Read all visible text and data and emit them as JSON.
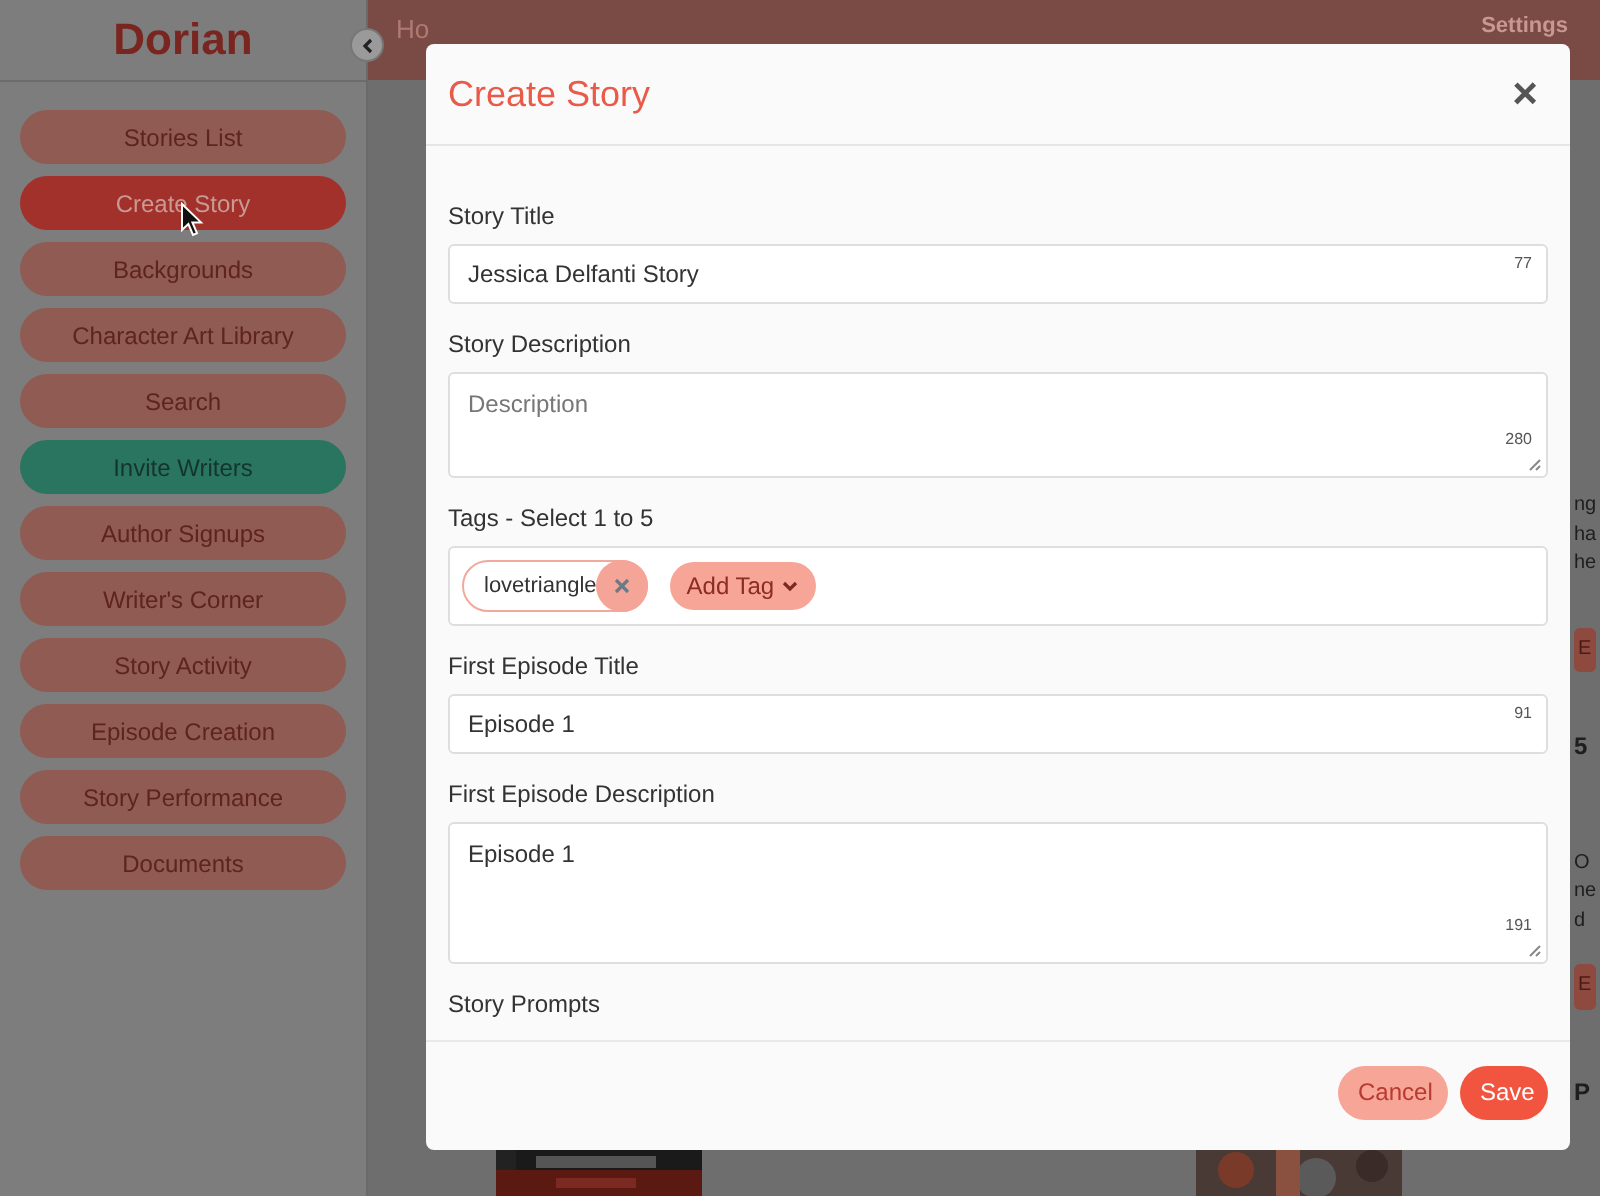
{
  "sidebar": {
    "brand": "Dorian",
    "items": [
      {
        "label": "Stories List",
        "selected": false,
        "kind": "nav"
      },
      {
        "label": "Create Story",
        "selected": true,
        "kind": "nav"
      },
      {
        "label": "Backgrounds",
        "selected": false,
        "kind": "nav"
      },
      {
        "label": "Character Art Library",
        "selected": false,
        "kind": "nav"
      },
      {
        "label": "Search",
        "selected": false,
        "kind": "nav"
      },
      {
        "label": "Invite Writers",
        "selected": false,
        "kind": "invite"
      },
      {
        "label": "Author Signups",
        "selected": false,
        "kind": "nav"
      },
      {
        "label": "Writer's Corner",
        "selected": false,
        "kind": "nav"
      },
      {
        "label": "Story Activity",
        "selected": false,
        "kind": "nav"
      },
      {
        "label": "Episode Creation",
        "selected": false,
        "kind": "nav"
      },
      {
        "label": "Story Performance",
        "selected": false,
        "kind": "nav"
      },
      {
        "label": "Documents",
        "selected": false,
        "kind": "nav"
      }
    ]
  },
  "header": {
    "home": "Ho",
    "settings": "Settings"
  },
  "background_fragments": [
    {
      "text": "ng",
      "kind": "text"
    },
    {
      "text": "ha",
      "kind": "text"
    },
    {
      "text": "he",
      "kind": "text"
    },
    {
      "text": "E",
      "kind": "button"
    },
    {
      "text": "5",
      "kind": "heading"
    },
    {
      "text": "O",
      "kind": "text"
    },
    {
      "text": "ne",
      "kind": "text"
    },
    {
      "text": "d",
      "kind": "text"
    },
    {
      "text": "E",
      "kind": "button"
    },
    {
      "text": "P",
      "kind": "heading"
    }
  ],
  "modal": {
    "title": "Create Story",
    "close": "×",
    "fields": [
      {
        "label": "Story Title",
        "kind": "input",
        "value": "Jessica Delfanti  Story",
        "counter": "77"
      },
      {
        "label": "Story Description",
        "kind": "textarea",
        "placeholder": "Description",
        "counter": "280"
      },
      {
        "label": "Tags - Select 1 to 5",
        "kind": "tags",
        "tags": [
          "lovetriangle"
        ],
        "add": "Add Tag"
      },
      {
        "label": "First Episode Title",
        "kind": "input",
        "value": "Episode 1",
        "counter": "91"
      },
      {
        "label": "First Episode Description",
        "kind": "textarea",
        "value": "Episode 1",
        "counter": "191"
      },
      {
        "label": "Story Prompts",
        "kind": "section"
      }
    ],
    "buttons": [
      {
        "label": "Cancel",
        "kind": "secondary"
      },
      {
        "label": "Save",
        "kind": "primary"
      }
    ]
  }
}
